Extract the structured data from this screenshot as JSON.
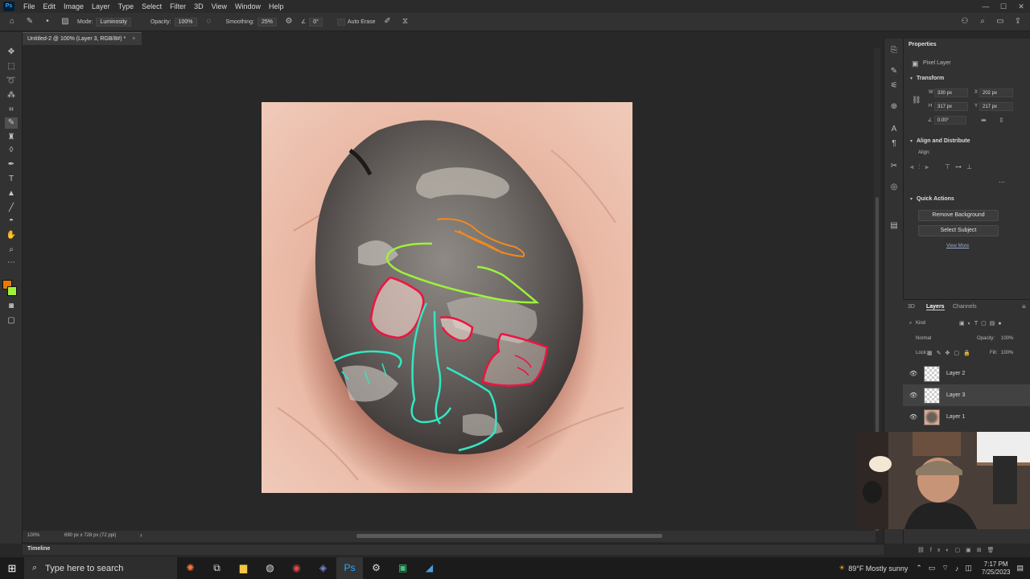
{
  "menubar": {
    "logo": "Ps",
    "items": [
      "File",
      "Edit",
      "Image",
      "Layer",
      "Type",
      "Select",
      "Filter",
      "3D",
      "View",
      "Window",
      "Help"
    ],
    "window_controls": [
      "—",
      "☐",
      "✕"
    ]
  },
  "options_bar": {
    "mode_label": "Mode:",
    "mode_value": "Luminosity",
    "opacity_label": "Opacity:",
    "opacity_value": "100%",
    "smoothing_label": "Smoothing:",
    "smoothing_value": "25%",
    "angle_value": "0°",
    "auto_erase_label": "Auto Erase"
  },
  "document_tab": {
    "title": "Untitled-2 @ 100% (Layer 3, RGB/8#) *",
    "close": "×"
  },
  "status_bar": {
    "zoom": "100%",
    "doc_size": "690 px x 728 px (72 ppi)"
  },
  "timeline": {
    "label": "Timeline"
  },
  "properties": {
    "tab": "Properties",
    "layer_type": "Pixel Layer",
    "transform_header": "Transform",
    "w_label": "W",
    "w_value": "330 px",
    "h_label": "H",
    "h_value": "317 px",
    "x_label": "X",
    "x_value": "202 px",
    "y_label": "Y",
    "y_value": "217 px",
    "angle_value": "0.00°",
    "align_header": "Align and Distribute",
    "align_label": "Align:",
    "quick_actions_header": "Quick Actions",
    "remove_bg": "Remove Background",
    "select_subject": "Select Subject",
    "view_more": "View More"
  },
  "layers_panel": {
    "tabs": [
      "3D",
      "Layers",
      "Channels"
    ],
    "filter_kind": "Kind",
    "blend_mode": "Normal",
    "opacity_label": "Opacity:",
    "opacity_value": "100%",
    "lock_label": "Lock:",
    "fill_label": "Fill:",
    "fill_value": "100%",
    "layers": [
      {
        "name": "Layer 2",
        "selected": false
      },
      {
        "name": "Layer 3",
        "selected": true
      },
      {
        "name": "Layer 1",
        "selected": false
      }
    ]
  },
  "taskbar": {
    "search_placeholder": "Type here to search",
    "weather": "89°F  Mostly sunny",
    "time": "7:17 PM",
    "date": "7/25/2023"
  },
  "colors": {
    "stroke_orange": "#f08a1e",
    "stroke_green": "#9cf23a",
    "stroke_red": "#ee1340",
    "stroke_cyan": "#34e6c2",
    "foreground_color": "#e87a00",
    "background_color": "#9cf23a"
  }
}
